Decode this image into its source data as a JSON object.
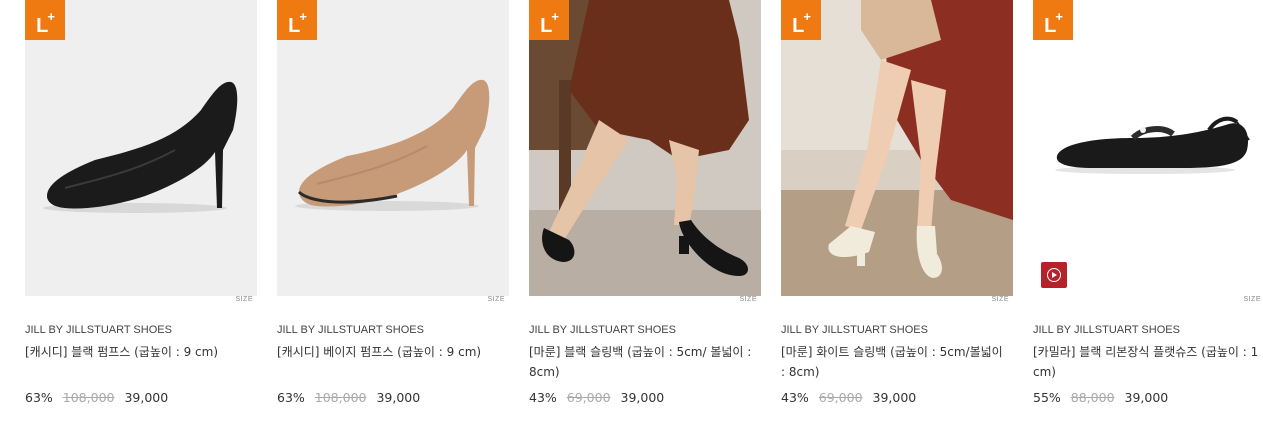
{
  "products": [
    {
      "badge": "L+",
      "size_label": "SIZE",
      "image_alt": "black pumps",
      "brand": "JILL BY JILLSTUART SHOES",
      "name": "[캐시디] 블랙 펌프스 (굽높이 : 9 cm)",
      "discount": "63%",
      "original_price": "108,000",
      "sale_price": "39,000"
    },
    {
      "badge": "L+",
      "size_label": "SIZE",
      "image_alt": "beige pumps",
      "brand": "JILL BY JILLSTUART SHOES",
      "name": "[캐시디] 베이지 펌프스 (굽높이 : 9 cm)",
      "discount": "63%",
      "original_price": "108,000",
      "sale_price": "39,000"
    },
    {
      "badge": "L+",
      "size_label": "SIZE",
      "image_alt": "black slingback model photo",
      "brand": "JILL BY JILLSTUART SHOES",
      "name": "[마룬] 블랙 슬링백 (굽높이 : 5cm/ 볼넓이 : 8cm)",
      "discount": "43%",
      "original_price": "69,000",
      "sale_price": "39,000"
    },
    {
      "badge": "L+",
      "size_label": "SIZE",
      "image_alt": "white slingback model photo",
      "brand": "JILL BY JILLSTUART SHOES",
      "name": "[마룬] 화이트 슬링백 (굽높이 : 5cm/볼넓이 : 8cm)",
      "discount": "43%",
      "original_price": "69,000",
      "sale_price": "39,000"
    },
    {
      "badge": "L+",
      "size_label": "SIZE",
      "image_alt": "black ribbon flat shoes",
      "brand": "JILL BY JILLSTUART SHOES",
      "name": "[카밀라] 블랙 리본장식 플랫슈즈 (굽높이 : 1 cm)",
      "discount": "55%",
      "original_price": "88,000",
      "sale_price": "39,000",
      "has_video": true
    }
  ],
  "colors": {
    "badge_bg": "#f07a12",
    "video_button": "#b5222a",
    "strike_price": "#aaaaaa"
  }
}
